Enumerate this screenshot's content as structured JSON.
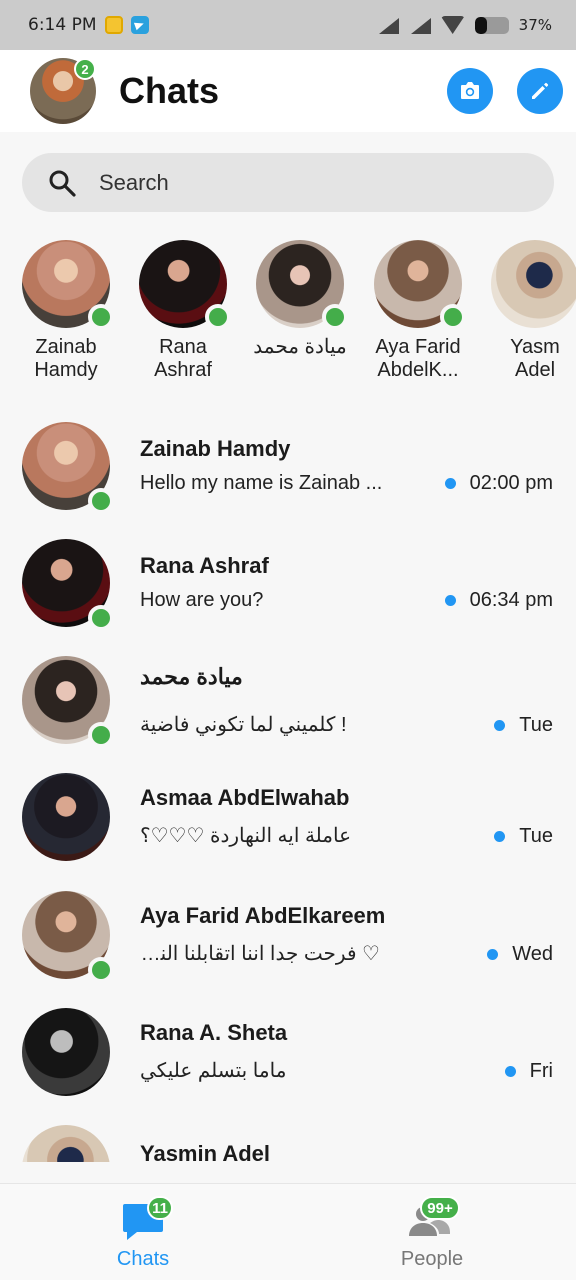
{
  "status_bar": {
    "time": "6:14 PM",
    "battery": "37%",
    "battery_level": 0.37
  },
  "header": {
    "title": "Chats",
    "profile_badge": "2"
  },
  "search": {
    "placeholder": "Search"
  },
  "stories": [
    {
      "name": "Zainab\nHamdy",
      "online": true
    },
    {
      "name": "Rana\nAshraf",
      "online": true
    },
    {
      "name": "ميادة محمد",
      "online": true
    },
    {
      "name": "Aya Farid\nAbdelK...",
      "online": true
    },
    {
      "name": "Yasm\nAdel",
      "online": false
    }
  ],
  "chats": [
    {
      "name": "Zainab Hamdy",
      "message": "Hello my name is Zainab ...",
      "time": "02:00 pm",
      "online": true,
      "unread": true
    },
    {
      "name": "Rana Ashraf",
      "message": "How are you?",
      "time": "06:34 pm",
      "online": true,
      "unread": true
    },
    {
      "name": "ميادة محمد",
      "message": "! كلميني لما تكوني فاضية",
      "time": "Tue",
      "online": true,
      "unread": true
    },
    {
      "name": "Asmaa AbdElwahab",
      "message": "عاملة ايه النهاردة ♡♡♡؟",
      "time": "Tue",
      "online": false,
      "unread": true
    },
    {
      "name": "Aya Farid AbdElkareem",
      "message": "♡ فرحت جدا اننا اتقابلنا النهاردة",
      "time": "Wed",
      "online": true,
      "unread": true
    },
    {
      "name": "Rana A. Sheta",
      "message": "ماما بتسلم عليكي",
      "time": "Fri",
      "online": false,
      "unread": true
    },
    {
      "name": "Yasmin Adel",
      "message": "",
      "time": "",
      "online": false,
      "unread": false
    }
  ],
  "bottom_nav": {
    "chats_label": "Chats",
    "chats_badge": "11",
    "people_label": "People",
    "people_badge": "99+"
  },
  "colors": {
    "accent": "#2196f3",
    "online": "#44ad4a"
  }
}
